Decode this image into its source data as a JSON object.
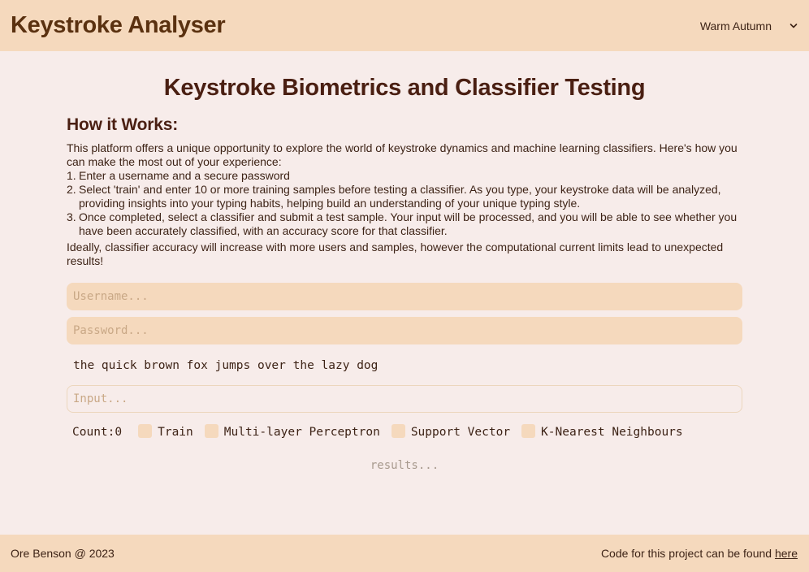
{
  "header": {
    "app_title": "Keystroke Analyser",
    "theme": "Warm Autumn"
  },
  "main": {
    "title": "Keystroke Biometrics and Classifier Testing",
    "how_heading": "How it Works:",
    "intro": "This platform offers a unique opportunity to explore the world of keystroke dynamics and machine learning classifiers. Here's how you can make the most out of your experience:",
    "steps": [
      {
        "num": "1.",
        "text": "Enter a username and a secure password"
      },
      {
        "num": "2.",
        "text": "Select 'train' and enter 10 or more training samples before testing a classifier. As you type, your keystroke data will be analyzed, providing insights into your typing habits, helping build an understanding of your unique typing style."
      },
      {
        "num": "3.",
        "text": "Once completed, select a classifier and submit a test sample. Your input will be processed, and you will be able to see whether you have been accurately classified, with an accuracy score for that classifier."
      }
    ],
    "note": "Ideally, classifier accuracy will increase with more users and samples, however the computational current limits lead to unexpected results!"
  },
  "form": {
    "username_placeholder": "Username...",
    "password_placeholder": "Password...",
    "prompt": "the quick brown fox jumps over the lazy dog",
    "input_placeholder": "Input...",
    "count_label": "Count:0",
    "options": [
      "Train",
      "Multi-layer Perceptron",
      "Support Vector",
      "K-Nearest Neighbours"
    ],
    "results_placeholder": "results..."
  },
  "footer": {
    "credit": "Ore Benson @ 2023",
    "code_text": "Code for this project can be found ",
    "link_text": "here"
  },
  "colors": {
    "bar_bg": "#f5d9bd",
    "page_bg": "#f7ecea",
    "heading": "#4a1f12"
  }
}
